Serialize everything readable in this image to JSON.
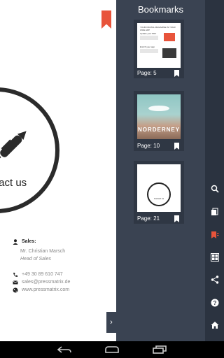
{
  "page": {
    "contact_title": "tact us",
    "sales_label": "Sales:",
    "sales_name": "Mr. Christian Marsch",
    "sales_role": "Head of Sales",
    "phone": "+49 30 89 610 747",
    "email": "sales@pressmatrix.de",
    "website": "www.pressmatrix.com"
  },
  "panel": {
    "title": "Bookmarks",
    "bookmarks": [
      {
        "label": "Page: 5"
      },
      {
        "label": "Page: 10"
      },
      {
        "label": "Page: 21"
      }
    ],
    "thumb1": {
      "heading": "YOUR DIGITAL MAGAZINE IN YOUR OWN APP",
      "sub1": "Update your PDF",
      "sub2": "Enrich your app"
    },
    "thumb2": {
      "text": "NORDERNEY"
    },
    "thumb3": {
      "text": "Contact us"
    }
  },
  "colors": {
    "accent": "#e8543b",
    "panel": "#3a4352",
    "sidebar": "#2b3340"
  }
}
